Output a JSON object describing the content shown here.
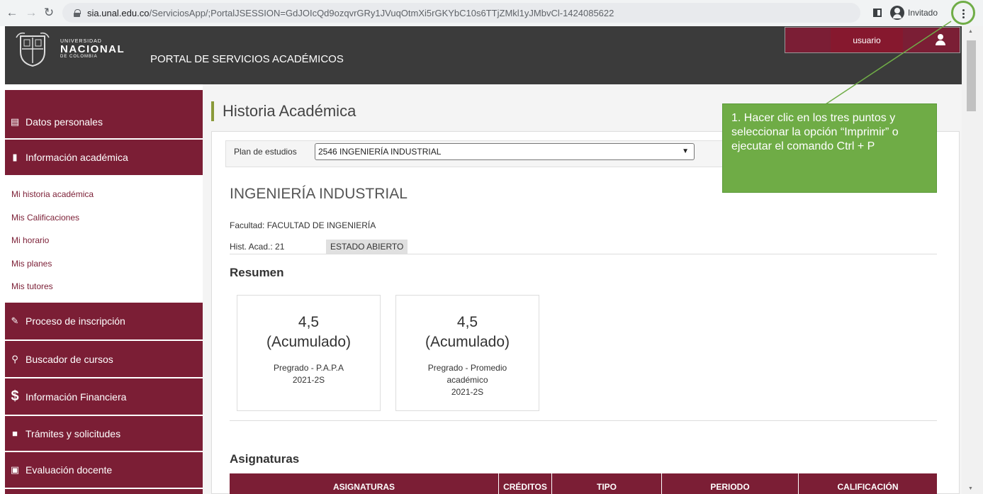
{
  "browser": {
    "url_host": "sia.unal.edu.co",
    "url_path": "/ServiciosApp/;PortalJSESSION=GdJOIcQd9ozqvrGRy1JVuqOtmXi5rGKYbC10s6TTjZMkl1yJMbvCl-1424085622",
    "profile_label": "Invitado"
  },
  "header": {
    "brand_line1": "UNIVERSIDAD",
    "brand_line2": "NACIONAL",
    "brand_line3": "DE COLOMBIA",
    "portal_title": "PORTAL DE SERVICIOS ACADÉMICOS",
    "user_label": "usuario"
  },
  "sidebar": {
    "items": [
      {
        "label": "Datos personales",
        "icon": "id-card-icon"
      },
      {
        "label": "Información académica",
        "icon": "book-icon"
      },
      {
        "label": "Proceso de inscripción",
        "icon": "edit-icon"
      },
      {
        "label": "Buscador de cursos",
        "icon": "search-plus-icon"
      },
      {
        "label": "Información Financiera",
        "icon": "dollar-icon"
      },
      {
        "label": "Trámites y solicitudes",
        "icon": "folder-icon"
      },
      {
        "label": "Evaluación docente",
        "icon": "form-icon"
      }
    ],
    "links": [
      "Mi historia académica",
      "Mis Calificaciones",
      "Mi horario",
      "Mis planes",
      "Mis tutores"
    ]
  },
  "main": {
    "page_title": "Historia Académica",
    "plan_label": "Plan de estudios",
    "plan_value": "2546 INGENIERÍA INDUSTRIAL",
    "career": "INGENIERÍA INDUSTRIAL",
    "facultad": "Facultad: FACULTAD DE INGENIERÍA",
    "hist": "Hist. Acad.: 21",
    "estado": "ESTADO ABIERTO",
    "resumen_title": "Resumen",
    "cards": [
      {
        "value": "4,5",
        "sub": "(Acumulado)",
        "label1": "Pregrado - P.A.P.A",
        "label2": "2021-2S"
      },
      {
        "value": "4,5",
        "sub": "(Acumulado)",
        "label1": "Pregrado - Promedio",
        "label2": "académico",
        "label3": "2021-2S"
      }
    ],
    "asignaturas_title": "Asignaturas",
    "table_headers": [
      "ASIGNATURAS",
      "CRÉDITOS",
      "TIPO",
      "PERIODO",
      "CALIFICACIÓN"
    ]
  },
  "annotation": {
    "text": "1. Hacer clic en los tres puntos y seleccionar la opción “Imprimir” o ejecutar el comando Ctrl + P"
  },
  "colors": {
    "primary": "#7b1e35",
    "header": "#3b3b3b",
    "note": "#6fac46",
    "accent_bar": "#8a9a3a"
  }
}
